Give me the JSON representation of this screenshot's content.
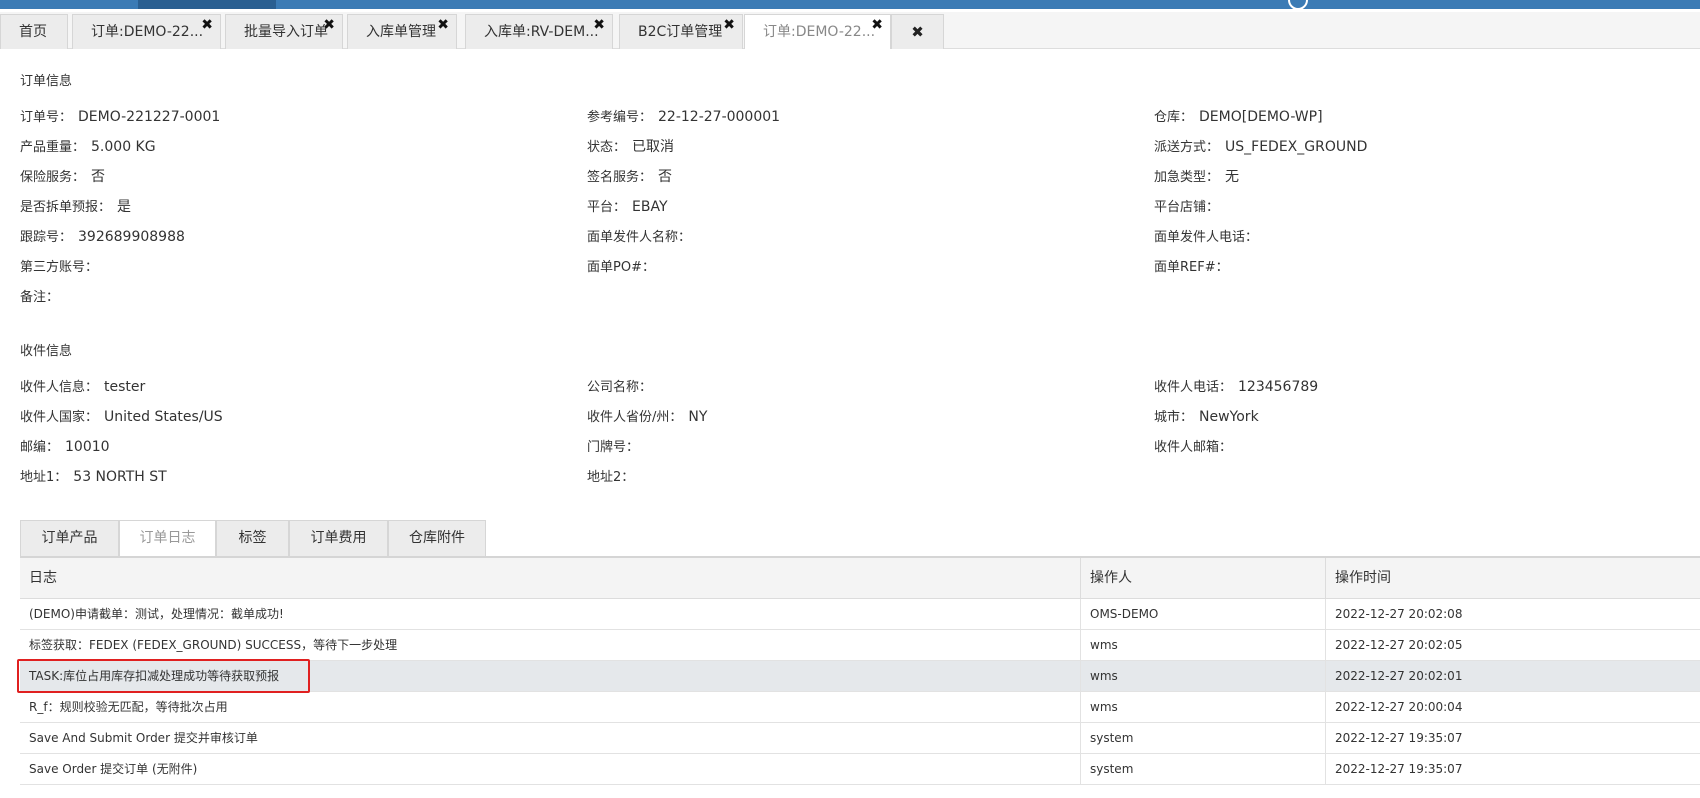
{
  "tabs": [
    {
      "label": "首页",
      "closable": false,
      "active": false
    },
    {
      "label": "订单:DEMO-22...",
      "closable": true,
      "active": false
    },
    {
      "label": "批量导入订单",
      "closable": true,
      "active": false
    },
    {
      "label": "入库单管理",
      "closable": true,
      "active": false
    },
    {
      "label": "入库单:RV-DEM...",
      "closable": true,
      "active": false
    },
    {
      "label": "B2C订单管理",
      "closable": true,
      "active": false
    },
    {
      "label": "订单:DEMO-22...",
      "closable": true,
      "active": true
    }
  ],
  "tab_close_glyph": "✖",
  "close_all_glyph": "✖",
  "order_info": {
    "title": "订单信息",
    "fields": [
      {
        "label": "订单号：",
        "value": "DEMO-221227-0001"
      },
      {
        "label": "参考编号：",
        "value": "22-12-27-000001"
      },
      {
        "label": "仓库：",
        "value": "DEMO[DEMO-WP]"
      },
      {
        "label": "产品重量：",
        "value": "5.000 KG"
      },
      {
        "label": "状态：",
        "value": "已取消"
      },
      {
        "label": "派送方式：",
        "value": "US_FEDEX_GROUND"
      },
      {
        "label": "保险服务：",
        "value": "否"
      },
      {
        "label": "签名服务：",
        "value": "否"
      },
      {
        "label": "加急类型：",
        "value": "无"
      },
      {
        "label": "是否拆单预报：",
        "value": "是"
      },
      {
        "label": "平台：",
        "value": "EBAY"
      },
      {
        "label": "平台店铺：",
        "value": ""
      },
      {
        "label": "跟踪号：",
        "value": "392689908988"
      },
      {
        "label": "面单发件人名称：",
        "value": ""
      },
      {
        "label": "面单发件人电话：",
        "value": ""
      },
      {
        "label": "第三方账号：",
        "value": ""
      },
      {
        "label": "面单PO#：",
        "value": ""
      },
      {
        "label": "面单REF#：",
        "value": ""
      },
      {
        "label": "备注：",
        "value": ""
      }
    ]
  },
  "receiver_info": {
    "title": "收件信息",
    "fields": [
      {
        "label": "收件人信息：",
        "value": "tester"
      },
      {
        "label": "公司名称：",
        "value": ""
      },
      {
        "label": "收件人电话：",
        "value": "123456789"
      },
      {
        "label": "收件人国家：",
        "value": "United States/US"
      },
      {
        "label": "收件人省份/州：",
        "value": "NY"
      },
      {
        "label": "城市：",
        "value": "NewYork"
      },
      {
        "label": "邮编：",
        "value": "10010"
      },
      {
        "label": "门牌号：",
        "value": ""
      },
      {
        "label": "收件人邮箱：",
        "value": ""
      },
      {
        "label": "地址1：",
        "value": "53 NORTH ST"
      },
      {
        "label": "地址2：",
        "value": ""
      }
    ]
  },
  "sub_tabs": [
    {
      "label": "订单产品",
      "active": false
    },
    {
      "label": "订单日志",
      "active": true
    },
    {
      "label": "标签",
      "active": false
    },
    {
      "label": "订单费用",
      "active": false
    },
    {
      "label": "仓库附件",
      "active": false
    }
  ],
  "log_table": {
    "columns": [
      "日志",
      "操作人",
      "操作时间"
    ],
    "rows": [
      {
        "log": "(DEMO)申请截单：测试，处理情况：截单成功!",
        "operator": "OMS-DEMO",
        "time": "2022-12-27 20:02:08",
        "selected": false
      },
      {
        "log": "标签获取：FEDEX (FEDEX_GROUND) SUCCESS，等待下一步处理",
        "operator": "wms",
        "time": "2022-12-27 20:02:05",
        "selected": false
      },
      {
        "log": "TASK:库位占用库存扣减处理成功等待获取预报",
        "operator": "wms",
        "time": "2022-12-27 20:02:01",
        "selected": true
      },
      {
        "log": "R_f：规则校验无匹配，等待批次占用",
        "operator": "wms",
        "time": "2022-12-27 20:00:04",
        "selected": false
      },
      {
        "log": "Save And Submit Order 提交并审核订单",
        "operator": "system",
        "time": "2022-12-27 19:35:07",
        "selected": false
      },
      {
        "log": "Save Order 提交订单 (无附件)",
        "operator": "system",
        "time": "2022-12-27 19:35:07",
        "selected": false
      }
    ]
  },
  "colors": {
    "topbar": "#3b7bb5",
    "highlight": "#e02020",
    "selected_row": "#e5e8eb"
  }
}
